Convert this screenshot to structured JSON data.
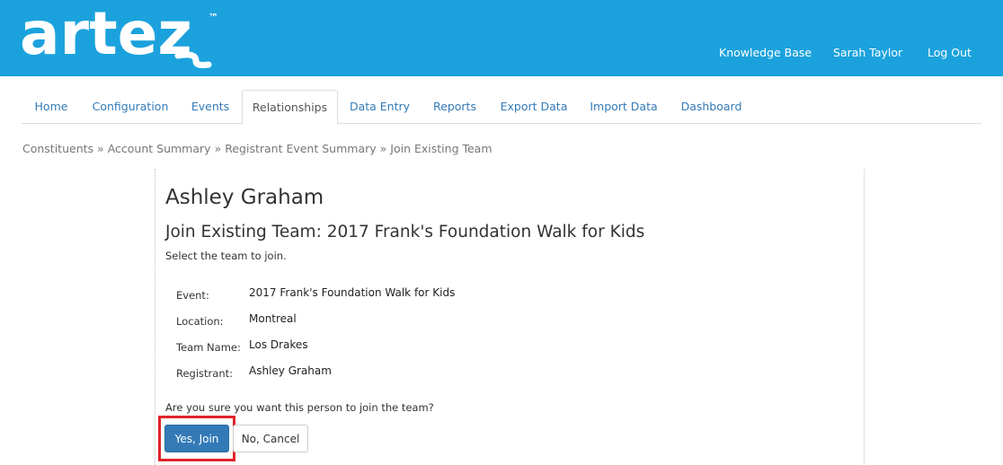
{
  "header": {
    "logo_text": "artez",
    "trademark": "™",
    "links": [
      {
        "label": "Knowledge Base"
      },
      {
        "label": "Sarah Taylor"
      },
      {
        "label": "Log Out"
      }
    ]
  },
  "tabs": [
    {
      "label": "Home",
      "active": false
    },
    {
      "label": "Configuration",
      "active": false
    },
    {
      "label": "Events",
      "active": false
    },
    {
      "label": "Relationships",
      "active": true
    },
    {
      "label": "Data Entry",
      "active": false
    },
    {
      "label": "Reports",
      "active": false
    },
    {
      "label": "Export Data",
      "active": false
    },
    {
      "label": "Import Data",
      "active": false
    },
    {
      "label": "Dashboard",
      "active": false
    }
  ],
  "breadcrumb": {
    "items": [
      "Constituents",
      "Account Summary",
      "Registrant Event Summary",
      "Join Existing Team"
    ],
    "separator": "»"
  },
  "main": {
    "person_name": "Ashley Graham",
    "title": "Join Existing Team: 2017 Frank's Foundation Walk for Kids",
    "instruction": "Select the team to join.",
    "details": [
      {
        "label": "Event:",
        "value": "2017 Frank's Foundation Walk for Kids"
      },
      {
        "label": "Location:",
        "value": "Montreal"
      },
      {
        "label": "Team Name:",
        "value": "Los Drakes"
      },
      {
        "label": "Registrant:",
        "value": "Ashley Graham"
      }
    ],
    "confirm_question": "Are you sure you want this person to join the team?",
    "yes_label": "Yes, Join",
    "no_label": "No, Cancel"
  },
  "colors": {
    "header_bg": "#1ba2dd",
    "primary_button": "#337ab7",
    "link": "#337ab7",
    "highlight": "#e0232b"
  }
}
